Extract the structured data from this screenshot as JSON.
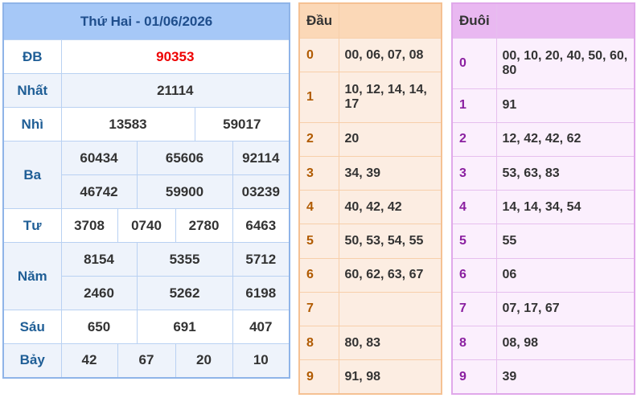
{
  "results": {
    "title": "Thứ Hai - 01/06/2026",
    "db": {
      "label": "ĐB",
      "value": "90353"
    },
    "nhat": {
      "label": "Nhất",
      "value": "21114"
    },
    "nhi": {
      "label": "Nhì",
      "values": [
        "13583",
        "59017"
      ]
    },
    "ba": {
      "label": "Ba",
      "values": [
        "60434",
        "65606",
        "92114",
        "46742",
        "59900",
        "03239"
      ]
    },
    "tu": {
      "label": "Tư",
      "values": [
        "3708",
        "0740",
        "2780",
        "6463"
      ]
    },
    "nam": {
      "label": "Năm",
      "values": [
        "8154",
        "5355",
        "5712",
        "2460",
        "5262",
        "6198"
      ]
    },
    "sau": {
      "label": "Sáu",
      "values": [
        "650",
        "691",
        "407"
      ]
    },
    "bay": {
      "label": "Bảy",
      "values": [
        "42",
        "67",
        "20",
        "10"
      ]
    }
  },
  "head": {
    "header": "Đầu",
    "rows": [
      {
        "digit": "0",
        "values": "00, 06, 07, 08"
      },
      {
        "digit": "1",
        "values": "10, 12, 14, 14, 17"
      },
      {
        "digit": "2",
        "values": "20"
      },
      {
        "digit": "3",
        "values": "34, 39"
      },
      {
        "digit": "4",
        "values": "40, 42, 42"
      },
      {
        "digit": "5",
        "values": "50, 53, 54, 55"
      },
      {
        "digit": "6",
        "values": "60, 62, 63, 67"
      },
      {
        "digit": "7",
        "values": ""
      },
      {
        "digit": "8",
        "values": "80, 83"
      },
      {
        "digit": "9",
        "values": "91, 98"
      }
    ]
  },
  "tail": {
    "header": "Đuôi",
    "rows": [
      {
        "digit": "0",
        "values": "00, 10, 20, 40, 50, 60, 80"
      },
      {
        "digit": "1",
        "values": "91"
      },
      {
        "digit": "2",
        "values": "12, 42, 42, 62"
      },
      {
        "digit": "3",
        "values": "53, 63, 83"
      },
      {
        "digit": "4",
        "values": "14, 14, 34, 54"
      },
      {
        "digit": "5",
        "values": "55"
      },
      {
        "digit": "6",
        "values": "06"
      },
      {
        "digit": "7",
        "values": "07, 17, 67"
      },
      {
        "digit": "8",
        "values": "08, 98"
      },
      {
        "digit": "9",
        "values": "39"
      }
    ]
  }
}
